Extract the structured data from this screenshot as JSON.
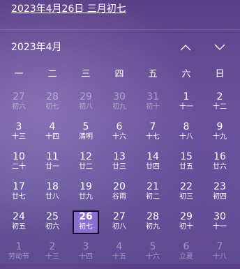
{
  "header": {
    "full_date": "2023年4月26日 三月初七"
  },
  "month_nav": {
    "title": "2023年4月",
    "up_icon": "chevron-up-icon",
    "down_icon": "chevron-down-icon"
  },
  "weekdays": [
    "一",
    "二",
    "三",
    "四",
    "五",
    "六",
    "日"
  ],
  "days": [
    {
      "day": "27",
      "lunar": "初六",
      "dim": true
    },
    {
      "day": "28",
      "lunar": "初七",
      "dim": true
    },
    {
      "day": "29",
      "lunar": "初八",
      "dim": true
    },
    {
      "day": "30",
      "lunar": "初九",
      "dim": true
    },
    {
      "day": "31",
      "lunar": "初十",
      "dim": true
    },
    {
      "day": "1",
      "lunar": "十一"
    },
    {
      "day": "2",
      "lunar": "十二"
    },
    {
      "day": "3",
      "lunar": "十三"
    },
    {
      "day": "4",
      "lunar": "十四"
    },
    {
      "day": "5",
      "lunar": "清明"
    },
    {
      "day": "6",
      "lunar": "十六"
    },
    {
      "day": "7",
      "lunar": "十七"
    },
    {
      "day": "8",
      "lunar": "十八"
    },
    {
      "day": "9",
      "lunar": "十九"
    },
    {
      "day": "10",
      "lunar": "二十"
    },
    {
      "day": "11",
      "lunar": "廿一"
    },
    {
      "day": "12",
      "lunar": "廿二"
    },
    {
      "day": "13",
      "lunar": "廿三"
    },
    {
      "day": "14",
      "lunar": "廿四"
    },
    {
      "day": "15",
      "lunar": "廿五"
    },
    {
      "day": "16",
      "lunar": "廿六"
    },
    {
      "day": "17",
      "lunar": "廿七"
    },
    {
      "day": "18",
      "lunar": "廿八"
    },
    {
      "day": "19",
      "lunar": "廿九"
    },
    {
      "day": "20",
      "lunar": "谷雨"
    },
    {
      "day": "21",
      "lunar": "初二"
    },
    {
      "day": "22",
      "lunar": "初三"
    },
    {
      "day": "23",
      "lunar": "初四"
    },
    {
      "day": "24",
      "lunar": "初五"
    },
    {
      "day": "25",
      "lunar": "初六"
    },
    {
      "day": "26",
      "lunar": "初七",
      "today": true
    },
    {
      "day": "27",
      "lunar": "初八"
    },
    {
      "day": "28",
      "lunar": "初九"
    },
    {
      "day": "29",
      "lunar": "初十"
    },
    {
      "day": "30",
      "lunar": "十一"
    },
    {
      "day": "1",
      "lunar": "劳动节",
      "dim": true
    },
    {
      "day": "2",
      "lunar": "十三",
      "dim": true
    },
    {
      "day": "3",
      "lunar": "十四",
      "dim": true
    },
    {
      "day": "4",
      "lunar": "十五",
      "dim": true
    },
    {
      "day": "5",
      "lunar": "十六",
      "dim": true
    },
    {
      "day": "6",
      "lunar": "立夏",
      "dim": true
    },
    {
      "day": "7",
      "lunar": "十八",
      "dim": true
    }
  ]
}
